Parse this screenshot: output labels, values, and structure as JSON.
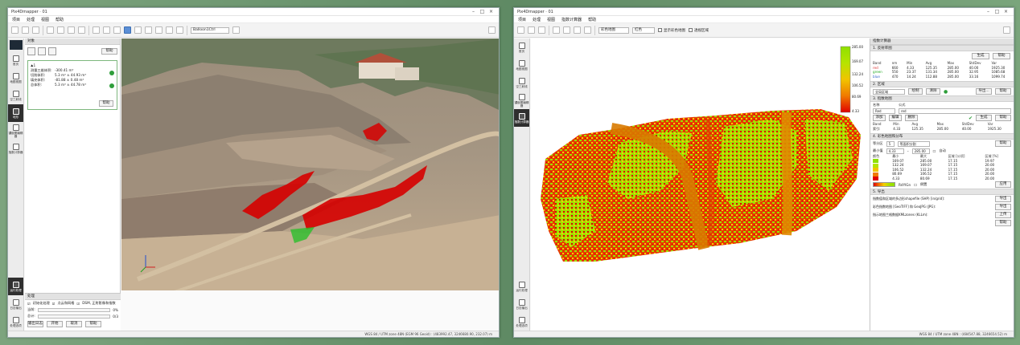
{
  "left": {
    "title": "Pix4Dmapper · 01",
    "menu": [
      "项目",
      "处理",
      "视图",
      "帮助"
    ],
    "toolbar_select": "Balloon1Ctrl",
    "sidebar": [
      {
        "label": "首页",
        "icon": "home-icon"
      },
      {
        "label": "地图视图",
        "icon": "map-icon"
      },
      {
        "label": "空三射线",
        "icon": "rays-icon"
      },
      {
        "label": "地形",
        "icon": "terrain-icon"
      },
      {
        "label": "镶嵌图编辑器",
        "icon": "mosaic-icon"
      },
      {
        "label": "指数计算器",
        "icon": "index-icon"
      }
    ],
    "sidebar_bottom": [
      {
        "label": "运行处理",
        "icon": "run-icon"
      },
      {
        "label": "日志输出",
        "icon": "log-icon"
      },
      {
        "label": "处理选项",
        "icon": "options-icon"
      }
    ],
    "panel_title": "对象",
    "help_label": "帮助",
    "object_name": "1",
    "metrics": [
      {
        "k": "测量三维体积:",
        "v": "-300.41 m³"
      },
      {
        "k": "切削体积:",
        "v": "5.3 m³ ± 44.93 m³"
      },
      {
        "k": "填充体积:",
        "v": "-81.88 ± 0.48 m³"
      },
      {
        "k": "总体积:",
        "v": "5.3 m³ ± 44.78 m³"
      }
    ],
    "calc_label": "帮助",
    "dock_title": "处理",
    "dock_tabs": [
      "初始化处理",
      "点云和网格",
      "DSM, 正射影像和指数"
    ],
    "dock_rows": [
      {
        "label": "当前:",
        "pct": "0%"
      },
      {
        "label": "总计:",
        "pct": "0/3"
      }
    ],
    "dock_buttons": [
      "输出日志",
      "开始",
      "取消",
      "帮助"
    ],
    "status": "WGS 84 / UTM zone 48N (EGM 96 Geoid) : (483992.47, 3246680.90, 232.07) m"
  },
  "right": {
    "title": "Pix4Dmapper · 01",
    "menu": [
      "项目",
      "处理",
      "视图",
      "指数计算器",
      "帮助"
    ],
    "toolbar_select": "彩色地图",
    "toolbar_select2": "红色",
    "toolbar_checks": [
      "显示彩色地图",
      "透视区域"
    ],
    "sidebar": [
      {
        "label": "首页",
        "icon": "home-icon"
      },
      {
        "label": "地图视图",
        "icon": "map-icon"
      },
      {
        "label": "空三射线",
        "icon": "rays-icon"
      },
      {
        "label": "镶嵌图编辑器",
        "icon": "mosaic-icon"
      },
      {
        "label": "指数计算器",
        "icon": "index-icon"
      }
    ],
    "sidebar_bottom": [
      {
        "label": "运行处理",
        "icon": "run-icon"
      },
      {
        "label": "日志输出",
        "icon": "log-icon"
      },
      {
        "label": "处理选项",
        "icon": "options-icon"
      }
    ],
    "legend_ticks": [
      "285.00",
      "169.07",
      "132.24",
      "106.52",
      "80.69",
      "4.33"
    ],
    "panel_title": "指数计算器",
    "sec1": "1. 反射率图",
    "sec1_buttons": [
      "生成",
      "帮助"
    ],
    "band_headers": [
      "Band",
      "nm",
      "Min",
      "Avg",
      "Max",
      "StdDev",
      "Var"
    ],
    "bands": [
      {
        "name": "red",
        "nm": "660",
        "min": "4.33",
        "avg": "125.35",
        "max": "285.00",
        "sd": "40.00",
        "var": "1925.30",
        "color": "#d33"
      },
      {
        "name": "green",
        "nm": "550",
        "min": "23.37",
        "avg": "131.34",
        "max": "285.00",
        "sd": "32.95",
        "var": "1085.68",
        "color": "#2a2"
      },
      {
        "name": "blue",
        "nm": "470",
        "min": "14.24",
        "avg": "112.88",
        "max": "285.00",
        "sd": "33.16",
        "var": "1099.74",
        "color": "#36c"
      }
    ],
    "sec2": "2. 区域",
    "sec2_select": "全局区域",
    "sec2_buttons": [
      "绘制",
      "清除",
      "导出...",
      "帮助"
    ],
    "sec3": "3. 指数地图",
    "sec3_cols": [
      "名称",
      "公式"
    ],
    "index_name": "Red",
    "index_formula": "red",
    "sec3_buttons": [
      "添加",
      "编辑",
      "删除",
      "生成",
      "帮助"
    ],
    "index_headers": [
      "Band",
      "Min",
      "Avg",
      "Max",
      "StdDev",
      "Var"
    ],
    "index_row": [
      "索引:",
      "4.33",
      "125.35",
      "285.00",
      "40.00",
      "1925.30"
    ],
    "sec4": "4. 彩色地图和分布",
    "sec4_mode_label": "等分区",
    "sec4_mode_count": "5",
    "sec4_mode_select": "等面积分割",
    "sec4_range_label": "最小值",
    "sec4_range_min": "4.33",
    "sec4_range_max": "285.00",
    "sec4_check": "自动",
    "sec4_help": "帮助",
    "class_headers": [
      "颜色",
      "最小",
      "最大",
      "区域 [公顷]",
      "区域 [%]"
    ],
    "classes": [
      {
        "color": "#8fe000",
        "min": "169.07",
        "max": "285.00",
        "ha": "17.15",
        "pct": "19.97"
      },
      {
        "color": "#b6e400",
        "min": "132.24",
        "max": "169.07",
        "ha": "17.15",
        "pct": "20.00"
      },
      {
        "color": "#f1c400",
        "min": "106.52",
        "max": "132.24",
        "ha": "17.15",
        "pct": "20.00"
      },
      {
        "color": "#f07a00",
        "min": "80.69",
        "max": "106.52",
        "ha": "17.15",
        "pct": "20.00"
      },
      {
        "color": "#e00000",
        "min": "4.33",
        "max": "80.69",
        "ha": "17.15",
        "pct": "20.00"
      }
    ],
    "ramp_name": "RdYlGn",
    "ramp_check": "倒置",
    "ramp_apply": "应用",
    "sec5": "5. 导出",
    "export_rows": [
      {
        "text": "指数值和区域的多边形shapefile (SHP) [in/grid]:",
        "btn": "导出"
      },
      {
        "text": "彩色指数地图 [GeoTIFF] 和 GeoJPG (JPG):",
        "btn": "导出"
      },
      {
        "text": "指示地图兰格数据KMLzones (KLLm):",
        "btn": "上传"
      }
    ],
    "export_help": "帮助",
    "status": "WGS 84 / UTM zone 48N : (484547.88, 3246654.52) m"
  }
}
